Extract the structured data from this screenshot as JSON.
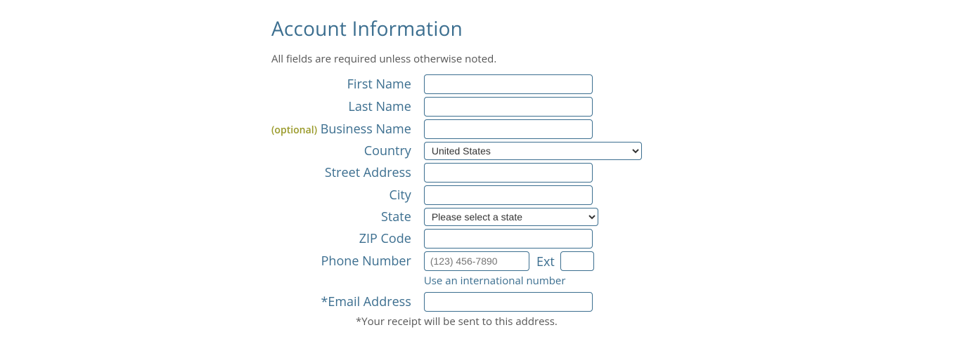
{
  "section_title": "Account Information",
  "required_note": "All fields are required unless otherwise noted.",
  "labels": {
    "first_name": "First Name",
    "last_name": "Last Name",
    "business_name": "Business Name",
    "optional": "(optional)",
    "country": "Country",
    "street": "Street Address",
    "city": "City",
    "state": "State",
    "zip": "ZIP Code",
    "phone": "Phone Number",
    "ext": "Ext",
    "email": "*Email Address"
  },
  "values": {
    "first_name": "",
    "last_name": "",
    "business_name": "",
    "country": "United States",
    "street": "",
    "city": "",
    "state": "Please select a state",
    "zip": "",
    "phone": "",
    "ext": "",
    "email": ""
  },
  "placeholders": {
    "phone": "(123) 456-7890"
  },
  "hints": {
    "intl": "Use an international number",
    "receipt": "*Your receipt will be sent to this address."
  }
}
